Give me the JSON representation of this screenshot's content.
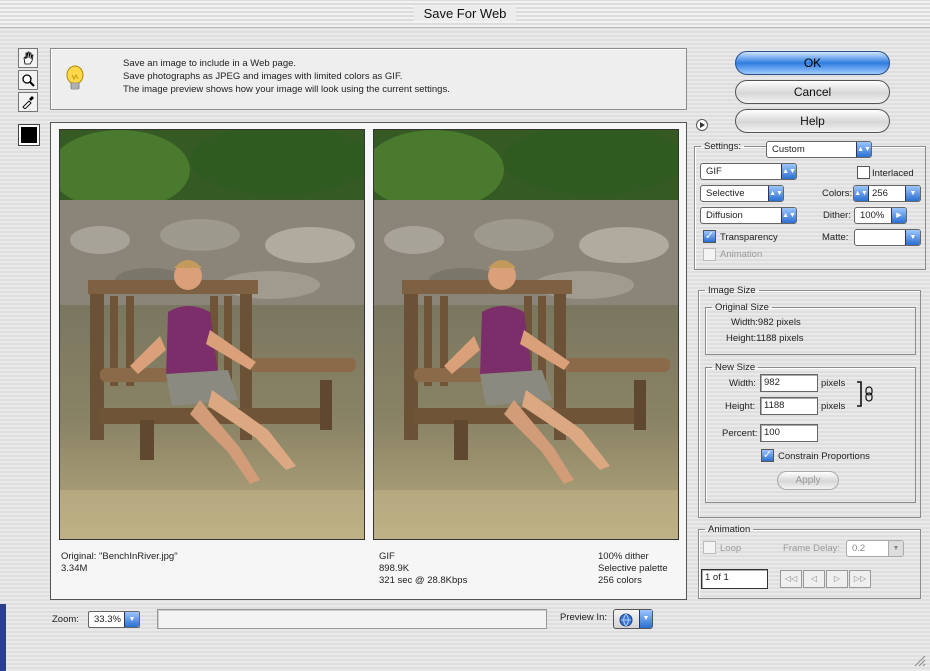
{
  "window": {
    "title": "Save For Web"
  },
  "info": {
    "line1": "Save an image to include in a Web page.",
    "line2": "Save photographs as JPEG and images with limited colors as GIF.",
    "line3": "The image preview shows how your image will look using the current settings."
  },
  "buttons": {
    "ok": "OK",
    "cancel": "Cancel",
    "help": "Help"
  },
  "original": {
    "caption_name": "Original: \"BenchInRiver.jpg\"",
    "caption_size": "3.34M"
  },
  "optimized": {
    "format": "GIF",
    "size": "898.9K",
    "time": "321 sec @ 28.8Kbps",
    "dither": "100% dither",
    "palette": "Selective palette",
    "colors": "256 colors"
  },
  "settings": {
    "label": "Settings:",
    "preset": "Custom",
    "format": "GIF",
    "reduction": "Selective",
    "dither_algo": "Diffusion",
    "interlaced_label": "Interlaced",
    "interlaced": false,
    "colors_label": "Colors:",
    "colors": "256",
    "dither_label": "Dither:",
    "dither": "100%",
    "transparency_label": "Transparency",
    "transparency": true,
    "matte_label": "Matte:",
    "matte": "",
    "animation_label": "Animation"
  },
  "image_size": {
    "legend": "Image Size",
    "original_legend": "Original Size",
    "orig_width": "Width:982 pixels",
    "orig_height": "Height:1188 pixels",
    "new_legend": "New Size",
    "width_label": "Width:",
    "width": "982",
    "height_label": "Height:",
    "height": "1188",
    "unit": "pixels",
    "percent_label": "Percent:",
    "percent": "100",
    "constrain_label": "Constrain Proportions",
    "constrain": true,
    "apply": "Apply"
  },
  "animation": {
    "legend": "Animation",
    "loop_label": "Loop",
    "frame_delay_label": "Frame Delay:",
    "frame_delay": "0.2",
    "frame_counter": "1 of 1"
  },
  "footer": {
    "zoom_label": "Zoom:",
    "zoom": "33.3%",
    "preview_label": "Preview In:"
  },
  "icons": [
    "hand-icon",
    "zoom-icon",
    "eyedropper-icon",
    "color-swatch-icon",
    "lightbulb-icon",
    "menu-arrow-icon",
    "link-icon",
    "browser-icon"
  ],
  "colors": {
    "accent": "#2f7de0",
    "swatch": "#000000"
  }
}
